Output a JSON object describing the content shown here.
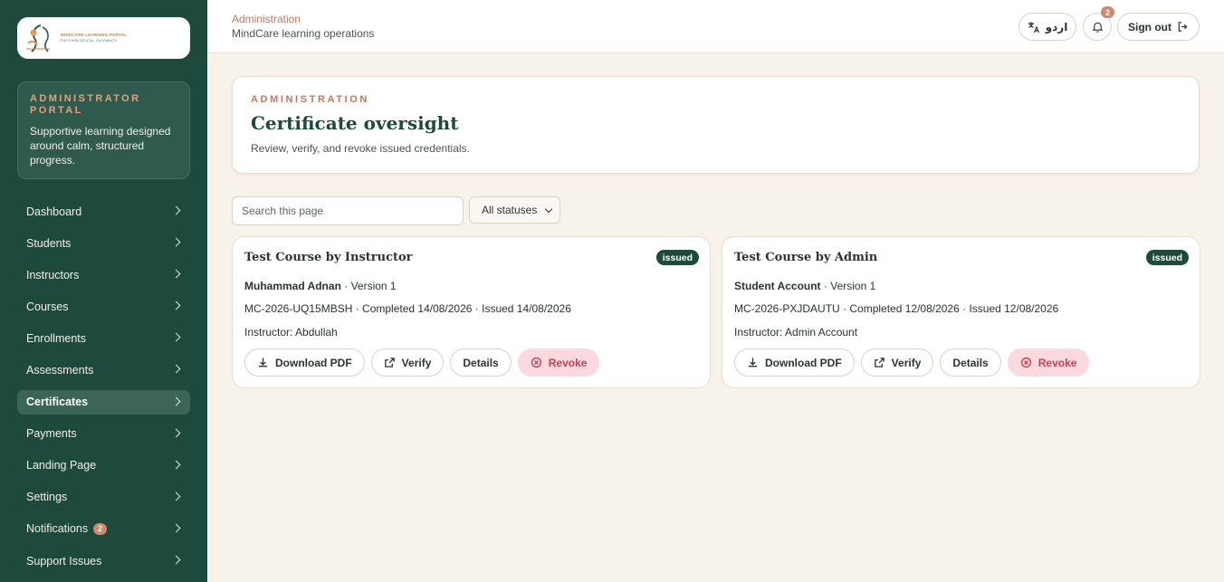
{
  "sidebar": {
    "logo": {
      "line1": "MINDCARE LEARNING PORTAL",
      "line2": "PSYCHOLOGICAL GUIDANCE"
    },
    "portal": {
      "title": "ADMINISTRATOR PORTAL",
      "description": "Supportive learning designed around calm, structured progress."
    },
    "items": [
      {
        "label": "Dashboard",
        "active": false
      },
      {
        "label": "Students",
        "active": false
      },
      {
        "label": "Instructors",
        "active": false
      },
      {
        "label": "Courses",
        "active": false
      },
      {
        "label": "Enrollments",
        "active": false
      },
      {
        "label": "Assessments",
        "active": false
      },
      {
        "label": "Certificates",
        "active": true
      },
      {
        "label": "Payments",
        "active": false
      },
      {
        "label": "Landing Page",
        "active": false
      },
      {
        "label": "Settings",
        "active": false
      },
      {
        "label": "Notifications",
        "active": false,
        "badge": "2"
      },
      {
        "label": "Support Issues",
        "active": false
      }
    ]
  },
  "header": {
    "breadcrumb": "Administration",
    "subtitle": "MindCare learning operations",
    "language_label": "اردو",
    "notification_count": "2",
    "signout_label": "Sign out"
  },
  "page": {
    "kicker": "ADMINISTRATION",
    "title": "Certificate oversight",
    "description": "Review, verify, and revoke issued credentials."
  },
  "filters": {
    "search_placeholder": "Search this page",
    "status_value": "All statuses"
  },
  "certificates": [
    {
      "course": "Test Course by Instructor",
      "status": "issued",
      "student": "Muhammad Adnan",
      "version": " · Version 1",
      "meta": "MC-2026-UQ15MBSH · Completed 14/08/2026 · Issued 14/08/2026",
      "instructor": "Instructor: Abdullah"
    },
    {
      "course": "Test Course by Admin",
      "status": "issued",
      "student": "Student Account",
      "version": " · Version 1",
      "meta": "MC-2026-PXJDAUTU · Completed 12/08/2026 · Issued 12/08/2026",
      "instructor": "Instructor: Admin Account"
    }
  ],
  "actions": {
    "download": "Download PDF",
    "verify": "Verify",
    "details": "Details",
    "revoke": "Revoke"
  },
  "colors": {
    "sidebar_bg": "#1e4a3d",
    "accent": "#c0785a",
    "page_bg": "#f7f2ea",
    "badge_bg": "#1e4a3d",
    "revoke_bg": "#fbd9df",
    "revoke_text": "#c83f4f"
  },
  "icons": [
    "translate-icon",
    "bell-icon",
    "sign-out-icon",
    "download-icon",
    "external-link-icon",
    "revoke-icon",
    "chevron-right-icon",
    "chevron-down-icon"
  ]
}
